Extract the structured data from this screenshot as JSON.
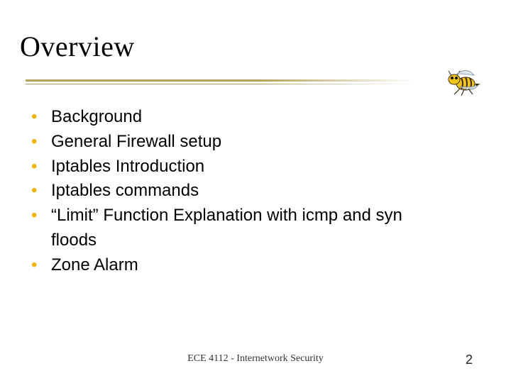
{
  "title": "Overview",
  "bullets": {
    "b0": "Background",
    "b1": "General Firewall setup",
    "b2": "Iptables Introduction",
    "b3": "Iptables commands",
    "b4": "“Limit” Function Explanation with icmp and syn floods",
    "b5": "Zone Alarm"
  },
  "footer": "ECE 4112 - Internetwork Security",
  "page_number": "2",
  "mascot_name": "buzz-yellowjacket-icon"
}
